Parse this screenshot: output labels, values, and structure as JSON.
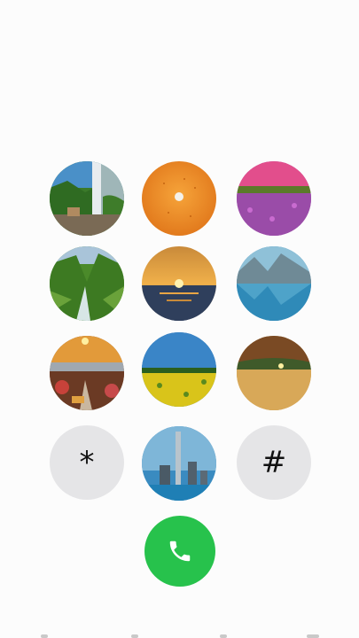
{
  "dialpad": {
    "star_label": "*",
    "hash_label": "#"
  },
  "colors": {
    "call_button": "#27c24c",
    "symbol_key_bg": "#e5e5e7",
    "background": "#fcfcfc"
  },
  "icons": {
    "call": "phone-icon"
  }
}
